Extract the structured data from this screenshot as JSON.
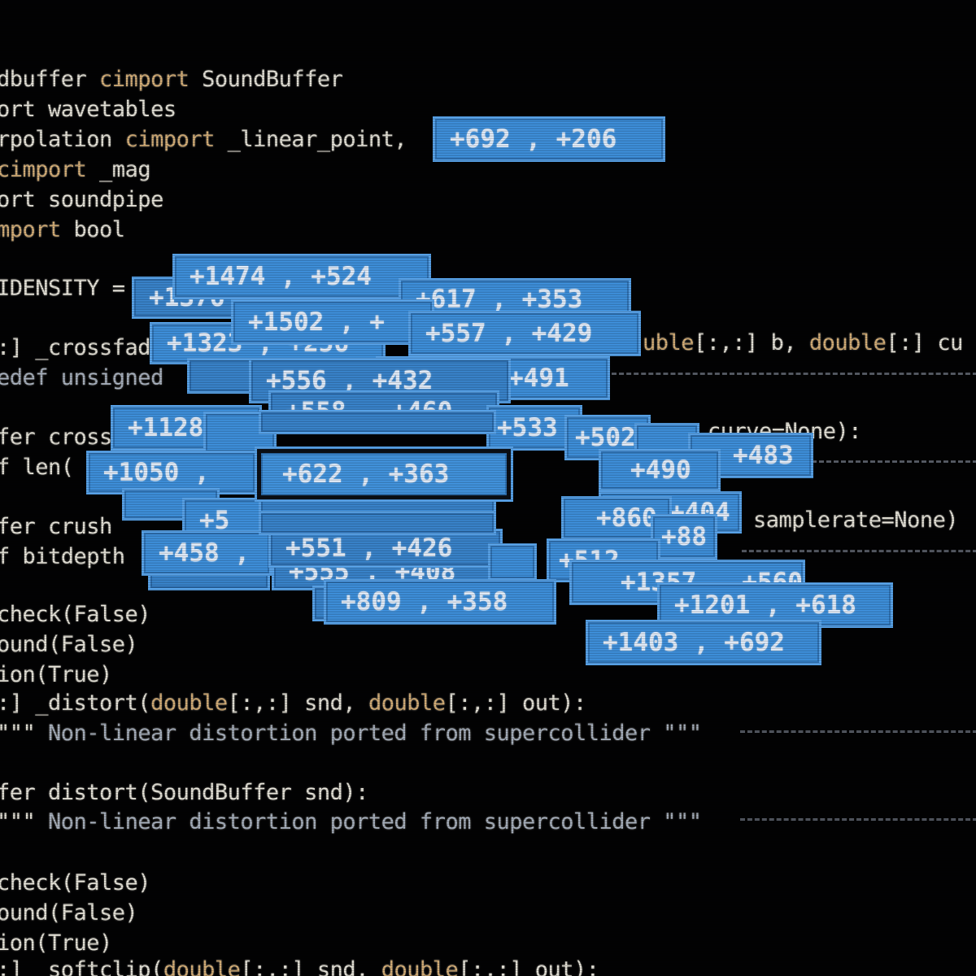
{
  "code": {
    "lines": [
      {
        "t": "dbuffer ",
        "k": "cimport",
        "r": " SoundBuffer"
      },
      {
        "t": "ort wavetables",
        "k": "",
        "r": ""
      },
      {
        "t": "rpolation ",
        "k": "cimport",
        "r": " _linear_point,"
      },
      {
        "t": "",
        "k": "cimport",
        "r": " _mag"
      },
      {
        "t": "ort soundpipe",
        "k": "",
        "r": ""
      },
      {
        "t": "",
        "k": "mport",
        "r": " bool"
      },
      {
        "t": "IDENSITY = ",
        "k": "",
        "r": ""
      },
      {
        "t": ":] _crossfad",
        "k": "",
        "r": ""
      },
      {
        "t": "",
        "k": "",
        "r": "",
        "c": "edef unsigned"
      },
      {
        "t": "fer cross",
        "k": "",
        "r": ""
      },
      {
        "t": "f len(",
        "k": "",
        "r": ""
      },
      {
        "t": "fer crush",
        "k": "",
        "r": ""
      },
      {
        "t": "f bitdepth",
        "k": "",
        "r": ""
      },
      {
        "t": "check(False)",
        "k": "",
        "r": ""
      },
      {
        "t": "ound(False)",
        "k": "",
        "r": ""
      },
      {
        "t": "ion(True)",
        "k": "",
        "r": ""
      },
      {
        "t": ":] _distort(",
        "k": "double",
        "r": "[:,:] snd, ",
        "k2": "double",
        "r2": "[:,:] out):"
      },
      {
        "t": "\"\"\" ",
        "k": "",
        "r": "",
        "c": "Non-linear distortion ported from supercollider \"\"\""
      },
      {
        "t": "fer distort(SoundBuffer snd):",
        "k": "",
        "r": ""
      },
      {
        "t": "\"\"\" ",
        "k": "",
        "r": "",
        "c": "Non-linear distortion ported from supercollider \"\"\""
      },
      {
        "t": "check(False)",
        "k": "",
        "r": ""
      },
      {
        "t": "ound(False)",
        "k": "",
        "r": ""
      },
      {
        "t": "ion(True)",
        "k": "",
        "r": ""
      },
      {
        "t": ":] _softclip(",
        "k": "double",
        "r": "[:,:] snd, ",
        "k2": "double",
        "r2": "[:,:] out):"
      }
    ],
    "right_fragments": {
      "crossfade_args": {
        "k": "uble",
        "r": "[:,:] b, ",
        "k2": "double",
        "r2": "[:] cu"
      },
      "crossfade_kw": "curve=None):",
      "crush_kw": "samplerate=None)"
    }
  },
  "overlay": {
    "accent": "#3f92df",
    "border": "#5aa6ee",
    "selected_label": "+622 , +363",
    "boxes": [
      "+692 , +206",
      "+1474 , +524",
      "+1376",
      "+617 , +353",
      "+1502 , +",
      "+557 , +429",
      "+1323 , +256",
      "+491",
      "+556 , +432",
      "+558 , +460",
      "+1128",
      "+533",
      "+502",
      "+483",
      "+460",
      "+1050 ,",
      "+490",
      "+404",
      "+560",
      "+5",
      "+860",
      "+88",
      "+458 ,",
      "+551 , +426",
      "+555 , +408",
      "+512",
      "+1357 , +560",
      "+809 , +358",
      "+1201 , +618",
      "+1403 , +692"
    ]
  }
}
